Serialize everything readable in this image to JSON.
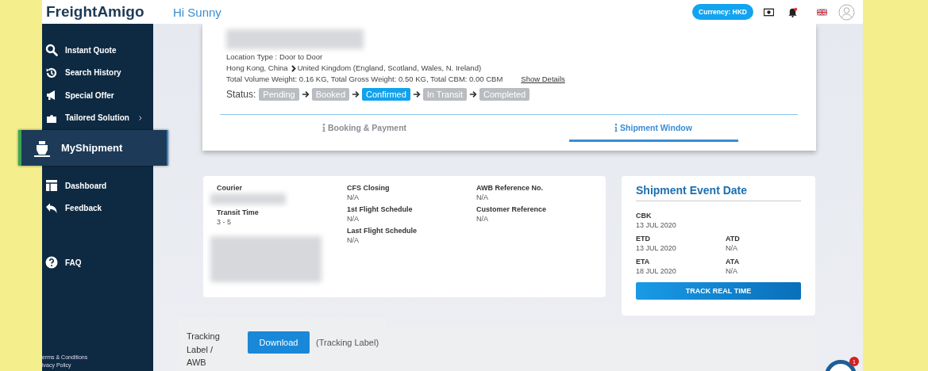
{
  "header": {
    "logo": "FreightAmigo",
    "greeting": "Hi Sunny",
    "currency_button": "Currency: HKD",
    "notification_dot": true
  },
  "sidebar": {
    "items": [
      {
        "label": "Instant Quote",
        "selected": false,
        "has_submenu": false
      },
      {
        "label": "Search History",
        "selected": false,
        "has_submenu": false
      },
      {
        "label": "Special Offer",
        "selected": false,
        "has_submenu": false
      },
      {
        "label": "Tailored Solution",
        "selected": false,
        "has_submenu": true
      },
      {
        "label": "MyShipment",
        "selected": true,
        "has_submenu": false
      },
      {
        "label": "Dashboard",
        "selected": false,
        "has_submenu": false
      },
      {
        "label": "Feedback",
        "selected": false,
        "has_submenu": false
      }
    ],
    "help_items": [
      {
        "label": "FAQ"
      }
    ],
    "footer_links": [
      "erms & Conditions",
      "ivacy Policy"
    ]
  },
  "shipment": {
    "location_type": "Location Type : Door to Door",
    "origin": "Hong Kong, China",
    "destination": "United Kingdom (England, Scotland, Wales, N. Ireland)",
    "totals": "Total Volume Weight: 0.16 KG, Total Gross Weight: 0.50 KG, Total CBM: 0.00 CBM",
    "details_link": "Show Details",
    "status_label": "Status:",
    "statuses": [
      {
        "label": "Pending",
        "current": false
      },
      {
        "label": "Booked",
        "current": false
      },
      {
        "label": "Confirmed",
        "current": true
      },
      {
        "label": "In Transit",
        "current": false
      },
      {
        "label": "Completed",
        "current": false
      }
    ],
    "tabs": [
      {
        "label": "Booking & Payment",
        "selected": false
      },
      {
        "label": "Shipment Window",
        "selected": true
      }
    ]
  },
  "details": {
    "columns": [
      [
        {
          "label": "Courier"
        },
        {
          "label": "Transit Time",
          "value": "3 - 5"
        }
      ],
      [
        {
          "label": "CFS Closing",
          "value": "N/A"
        },
        {
          "label": "1st Flight Schedule",
          "value": "N/A"
        },
        {
          "label": "Last Flight Schedule",
          "value": "N/A"
        }
      ],
      [
        {
          "label": "AWB Reference No.",
          "value": "N/A"
        },
        {
          "label": "Customer Reference",
          "value": "N/A"
        }
      ]
    ]
  },
  "event_dates": {
    "title": "Shipment Event Date",
    "rows": [
      [
        {
          "label": "CBK",
          "value": "13 JUL 2020"
        }
      ],
      [
        {
          "label": "ETD",
          "value": "13 JUL 2020"
        },
        {
          "label": "ATD",
          "value": "N/A"
        }
      ],
      [
        {
          "label": "ETA",
          "value": "18 JUL 2020"
        },
        {
          "label": "ATA",
          "value": "N/A"
        }
      ]
    ],
    "button": "TRACK REAL TIME"
  },
  "documents": {
    "label": "Tracking Label / AWB",
    "button": "Download",
    "note": "(Tracking Label)"
  },
  "chat": {
    "badge": "1"
  }
}
